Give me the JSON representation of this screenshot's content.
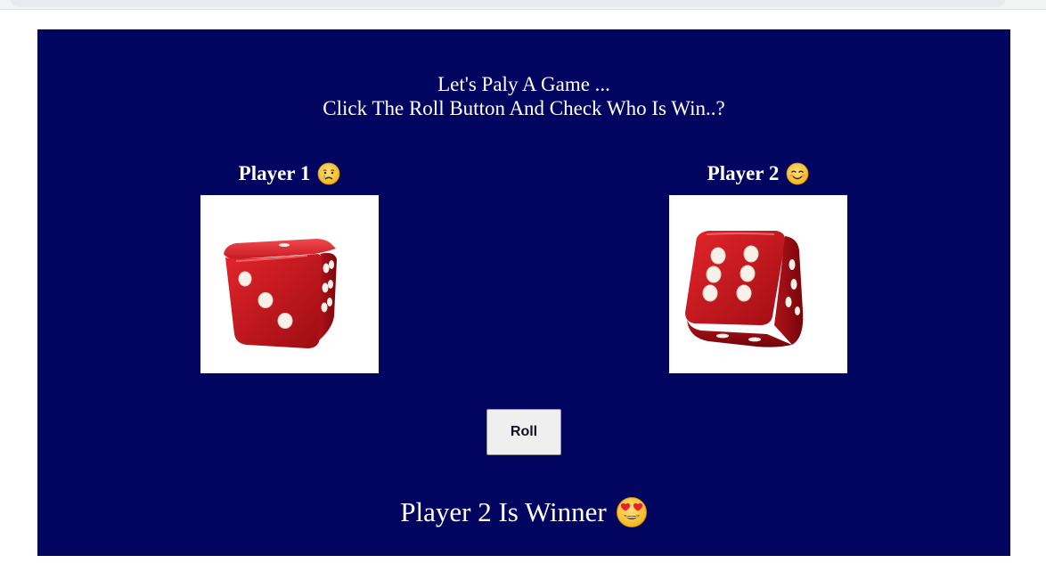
{
  "game": {
    "intro_line1": "Let's Paly A Game ...",
    "intro_line2": "Click The Roll Button And Check Who Is Win..?",
    "players": [
      {
        "label": "Player 1",
        "mood_icon": "sad-face-icon",
        "dice_value": 3
      },
      {
        "label": "Player 2",
        "mood_icon": "smiling-face-icon",
        "dice_value": 6
      }
    ],
    "roll_label": "Roll",
    "result_text": "Player 2 Is Winner",
    "result_icon": "heart-eyes-face-icon"
  },
  "colors": {
    "panel_background": "#020560",
    "dice_red": "#c4161c",
    "text": "#ffffff"
  }
}
